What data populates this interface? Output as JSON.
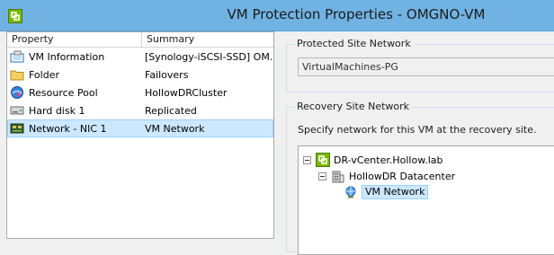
{
  "window": {
    "title": "VM Protection Properties - OMGNO-VM",
    "app_icon": "vsphere-icon"
  },
  "properties_grid": {
    "headers": {
      "property": "Property",
      "summary": "Summary"
    },
    "rows": [
      {
        "icon": "vm-info-icon",
        "property": "VM Information",
        "summary": "[Synology-iSCSI-SSD] OM..."
      },
      {
        "icon": "folder-icon",
        "property": "Folder",
        "summary": "Failovers"
      },
      {
        "icon": "resource-pool-icon",
        "property": "Resource Pool",
        "summary": "HollowDRCluster"
      },
      {
        "icon": "hard-disk-icon",
        "property": "Hard disk 1",
        "summary": "Replicated"
      },
      {
        "icon": "nic-icon",
        "property": "Network - NIC 1",
        "summary": "VM Network",
        "selected": true
      }
    ]
  },
  "protected_site": {
    "label": "Protected Site Network",
    "value": "VirtualMachines-PG"
  },
  "recovery_site": {
    "label": "Recovery Site Network",
    "hint": "Specify network for this VM at the recovery site.",
    "tree": {
      "vcenter": "DR-vCenter.Hollow.lab",
      "datacenter": "HollowDR Datacenter",
      "network": "VM Network"
    }
  },
  "colors": {
    "titlebar": "#70b3e3",
    "selection": "#cce8ff",
    "selection_border": "#99d1ff"
  }
}
